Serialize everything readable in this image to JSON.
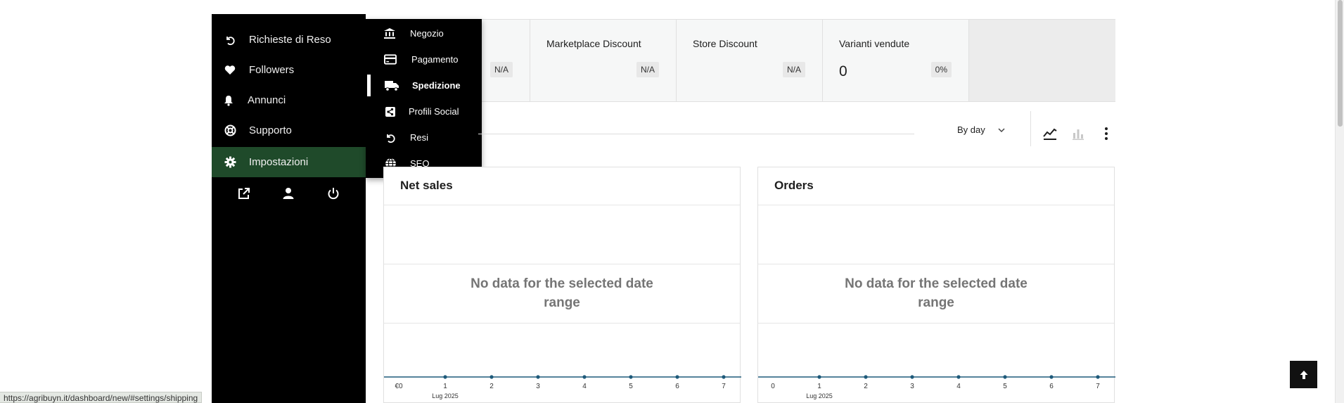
{
  "sidebar": {
    "items": [
      {
        "label": "Richieste di Reso",
        "icon": "undo-icon"
      },
      {
        "label": "Followers",
        "icon": "heart-icon"
      },
      {
        "label": "Annunci",
        "icon": "bell-icon"
      },
      {
        "label": "Supporto",
        "icon": "lifebuoy-icon"
      },
      {
        "label": "Impostazioni",
        "icon": "gear-icon",
        "active": true
      }
    ],
    "footer": [
      "external-link-icon",
      "user-icon",
      "power-icon"
    ]
  },
  "submenu": {
    "items": [
      {
        "label": "Negozio",
        "icon": "bank-icon"
      },
      {
        "label": "Pagamento",
        "icon": "credit-card-icon"
      },
      {
        "label": "Spedizione",
        "icon": "truck-icon",
        "active": true
      },
      {
        "label": "Profili Social",
        "icon": "share-icon"
      },
      {
        "label": "Resi",
        "icon": "undo-icon"
      },
      {
        "label": "SEO",
        "icon": "globe-icon"
      }
    ]
  },
  "stats": [
    {
      "title": "",
      "value": "",
      "delta": "N/A"
    },
    {
      "title": "Marketplace Discount",
      "value": "",
      "delta": "N/A"
    },
    {
      "title": "Store Discount",
      "value": "",
      "delta": "N/A"
    },
    {
      "title": "Varianti vendute",
      "value": "0",
      "delta": "0%"
    }
  ],
  "interval": {
    "label": "By day"
  },
  "charts": [
    {
      "title": "Net sales",
      "empty_message": "No data for the selected date range",
      "x_ticks": [
        "€0",
        "1",
        "2",
        "3",
        "4",
        "5",
        "6",
        "7"
      ],
      "x_caption": "Lug 2025"
    },
    {
      "title": "Orders",
      "empty_message": "No data for the selected date range",
      "x_ticks": [
        "0",
        "1",
        "2",
        "3",
        "4",
        "5",
        "6",
        "7"
      ],
      "x_caption": "Lug 2025"
    }
  ],
  "status_url": "https://agribuyn.it/dashboard/new/#settings/shipping",
  "colors": {
    "sidebar_bg": "#000000",
    "active_bg": "#1f4a2a",
    "line_series": "#1e5a7a"
  }
}
